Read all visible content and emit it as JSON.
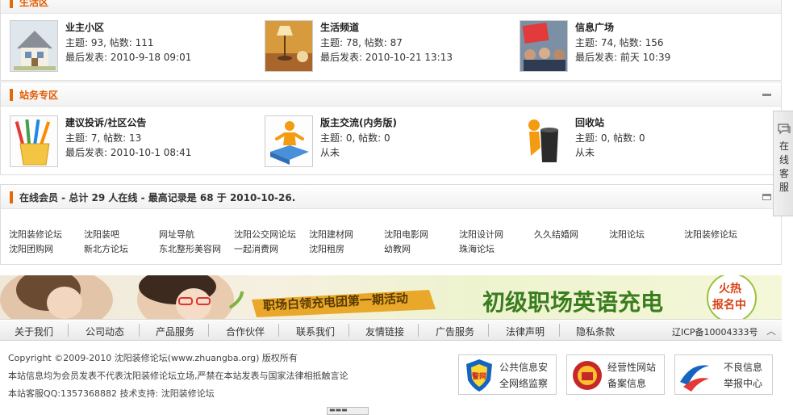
{
  "sections": {
    "life": {
      "title": "生活区",
      "forums": [
        {
          "name": "业主小区",
          "stats": "主题: 93, 帖数: 111",
          "last": "最后发表: 2010-9-18 09:01",
          "icon": "house-icon"
        },
        {
          "name": "生活频道",
          "stats": "主题: 78, 帖数: 87",
          "last": "最后发表: 2010-10-21 13:13",
          "icon": "lamp-icon"
        },
        {
          "name": "信息广场",
          "stats": "主题: 74, 帖数: 156",
          "last": "最后发表: 前天 10:39",
          "icon": "crowd-photo-icon"
        }
      ]
    },
    "station": {
      "title": "站务专区",
      "forums": [
        {
          "name": "建议投诉/社区公告",
          "stats": "主题: 7, 帖数: 13",
          "last": "最后发表: 2010-10-1 08:41",
          "icon": "pencil-cup-icon"
        },
        {
          "name": "版主交流(内务版)",
          "stats": "主题: 0, 帖数: 0",
          "last": "从未",
          "icon": "puzzle-person-icon"
        },
        {
          "name": "回收站",
          "stats": "主题: 0, 帖数: 0",
          "last": "从未",
          "icon": "trash-person-icon"
        }
      ]
    },
    "online": {
      "title": "在线会员 - 总计 29 人在线 - 最高记录是 68 于 2010-10-26.",
      "links": [
        "沈阳装修论坛",
        "沈阳装吧",
        "网址导航",
        "沈阳公交网论坛",
        "沈阳建材网",
        "沈阳电影网",
        "沈阳设计网",
        "久久结婚网",
        "沈阳论坛",
        "沈阳装修论坛",
        "沈阳团购网",
        "新北方论坛",
        "东北整形美容网",
        "一起消费网",
        "沈阳租房",
        "幼教网",
        "珠海论坛"
      ]
    }
  },
  "banner": {
    "slogan": "职场白领充电团第一期活动",
    "headline": "初级职场英语充电",
    "badge_line1": "火热",
    "badge_line2": "报名中"
  },
  "nav": {
    "items": [
      "关于我们",
      "公司动态",
      "产品服务",
      "合作伙伴",
      "联系我们",
      "友情链接",
      "广告服务",
      "法律声明",
      "隐私条款"
    ],
    "icp": "辽ICP备10004333号"
  },
  "footer": {
    "copyright": "Copyright ©2009-2010 沈阳装修论坛(www.zhuangba.org) 版权所有",
    "disclaimer": "本站信息均为会员发表不代表沈阳装修论坛立场,严禁在本站发表与国家法律相抵触言论",
    "contact": "本站客服QQ:1357368882  技术支持: 沈阳装修论坛"
  },
  "badges": [
    {
      "line1": "公共信息安",
      "line2": "全网络监察",
      "icon": "police-shield-icon"
    },
    {
      "line1": "经营性网站",
      "line2": "备案信息",
      "icon": "emblem-icon"
    },
    {
      "line1": "不良信息",
      "line2": "举报中心",
      "icon": "report-swoosh-icon"
    }
  ],
  "side_tab": {
    "label": "在线客服"
  },
  "colors": {
    "accent": "#e15a00",
    "bar": "#e46a07",
    "banner_green": "#3a7d1e"
  }
}
